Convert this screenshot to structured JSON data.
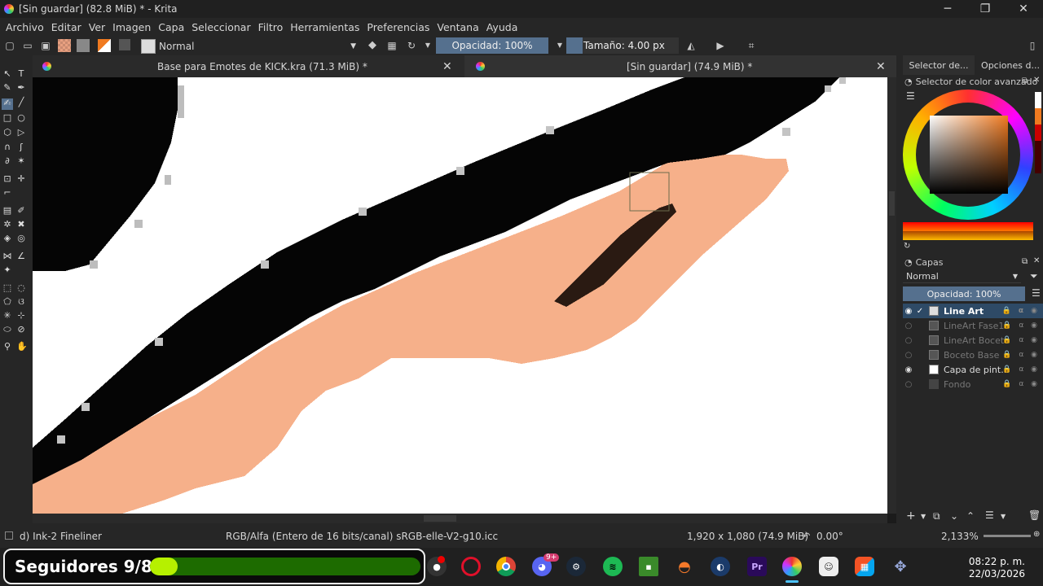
{
  "window": {
    "title": "[Sin guardar]  (82.8 MiB) * - Krita",
    "minimize": "─",
    "maximize": "❐",
    "close": "✕"
  },
  "menu": [
    "Archivo",
    "Editar",
    "Ver",
    "Imagen",
    "Capa",
    "Seleccionar",
    "Filtro",
    "Herramientas",
    "Preferencias",
    "Ventana",
    "Ayuda"
  ],
  "toolbar": {
    "blend_mode": "Normal",
    "opacity": "Opacidad: 100%",
    "size": "Tamaño: 4.00 px"
  },
  "tabs": [
    {
      "title": "Base para Emotes de KICK.kra (71.3 MiB) *"
    },
    {
      "title": "[Sin guardar]  (74.9 MiB) *"
    }
  ],
  "right_tabs": [
    "Selector de...",
    "Opciones d..."
  ],
  "color_panel": {
    "title": "Selector de color avanzado",
    "accent": "#f07a20"
  },
  "layers_panel": {
    "title": "Capas",
    "blend_mode": "Normal",
    "opacity": "Opacidad:  100%",
    "layers": [
      {
        "name": "Line Art",
        "visible": true,
        "active": true
      },
      {
        "name": "LineArt Fase1",
        "visible": false,
        "active": false
      },
      {
        "name": "LineArt Boceto",
        "visible": false,
        "active": false
      },
      {
        "name": "Boceto Base",
        "visible": false,
        "active": false
      },
      {
        "name": "Capa de pint...",
        "visible": true,
        "active": false
      },
      {
        "name": "Fondo",
        "visible": false,
        "active": false
      }
    ]
  },
  "status": {
    "brush": "d) Ink-2 Fineliner",
    "colorspace": "RGB/Alfa (Entero de 16 bits/canal)  sRGB-elle-V2-g10.icc",
    "dimensions": "1,920 x 1,080 (74.9 MiB)",
    "rotation": "0.00°",
    "zoom": "2,133%"
  },
  "widget": {
    "label": "Seguidores 9/88",
    "progress": 0.102
  },
  "clock": {
    "time": "08:22 p. m.",
    "date": "22/03/2026"
  },
  "taskbar_apps": [
    "OBS",
    "Opera",
    "Chrome",
    "Discord",
    "Steam",
    "Spotify",
    "Minecraft",
    "Blender",
    "Cinema 4D",
    "Premiere Pro",
    "Krita",
    "Game",
    "Store",
    "App"
  ],
  "discord_badge": "9+",
  "canvas": {
    "skin_color": "#f6b08a",
    "ink_color": "#050505"
  }
}
